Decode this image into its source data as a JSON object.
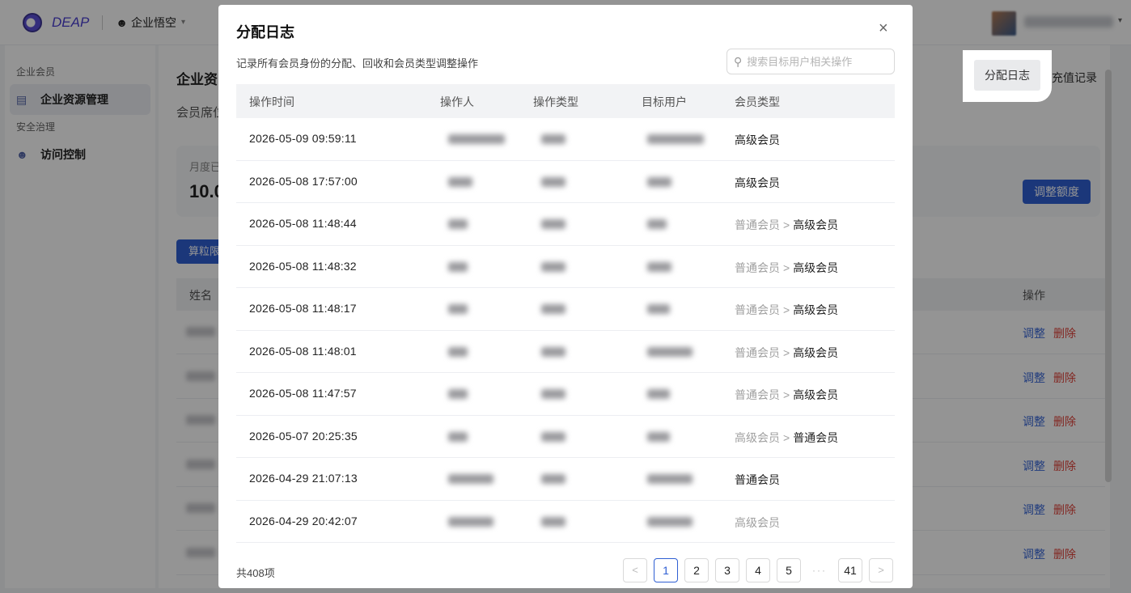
{
  "topbar": {
    "brand": "DEAP",
    "project_icon": "team-icon",
    "project": "企业悟空",
    "project_caret": "▾"
  },
  "sidebar": {
    "groups": [
      {
        "label": "企业会员",
        "items": [
          {
            "label": "企业资源管理",
            "icon": "list-icon",
            "active": true
          }
        ]
      },
      {
        "label": "安全治理",
        "items": [
          {
            "label": "访问控制",
            "icon": "team-icon",
            "active": false
          }
        ]
      }
    ]
  },
  "background_page": {
    "title": "企业资",
    "subtitle": "会员席位",
    "stat_label": "月度已",
    "stat_value": "10.0",
    "tab_label": "算粒限",
    "col_name": "姓名",
    "col_action": "操作",
    "edit_label": "调整",
    "delete_label": "删除",
    "adjust_button": "调整额度",
    "recharge_link": "充值记录",
    "log_button": "分配日志"
  },
  "modal": {
    "title": "分配日志",
    "close_icon": "×",
    "description": "记录所有会员身份的分配、回收和会员类型调整操作",
    "search_placeholder": "搜索目标用户相关操作",
    "columns": [
      "操作时间",
      "操作人",
      "操作类型",
      "目标用户",
      "会员类型"
    ],
    "rows": [
      {
        "time": "2026-05-09 09:59:11",
        "type_from": "",
        "type_to": "高级会员",
        "type_style": "plain"
      },
      {
        "time": "2026-05-08 17:57:00",
        "type_from": "",
        "type_to": "高级会员",
        "type_style": "plain"
      },
      {
        "time": "2026-05-08 11:48:44",
        "type_from": "普通会员",
        "type_to": "高级会员",
        "type_style": "change"
      },
      {
        "time": "2026-05-08 11:48:32",
        "type_from": "普通会员",
        "type_to": "高级会员",
        "type_style": "change"
      },
      {
        "time": "2026-05-08 11:48:17",
        "type_from": "普通会员",
        "type_to": "高级会员",
        "type_style": "change"
      },
      {
        "time": "2026-05-08 11:48:01",
        "type_from": "普通会员",
        "type_to": "高级会员",
        "type_style": "change"
      },
      {
        "time": "2026-05-08 11:47:57",
        "type_from": "普通会员",
        "type_to": "高级会员",
        "type_style": "change"
      },
      {
        "time": "2026-05-07 20:25:35",
        "type_from": "高级会员",
        "type_to": "普通会员",
        "type_style": "change"
      },
      {
        "time": "2026-04-29 21:07:13",
        "type_from": "",
        "type_to": "普通会员",
        "type_style": "plain"
      },
      {
        "time": "2026-04-29 20:42:07",
        "type_from": "",
        "type_to": "高级会员",
        "type_style": "muted"
      }
    ],
    "arrow": ">",
    "total_text": "共408项",
    "pagination": {
      "prev": "<",
      "pages": [
        "1",
        "2",
        "3",
        "4",
        "5"
      ],
      "current": "1",
      "ellipsis": "···",
      "last": "41",
      "next": ">"
    }
  }
}
